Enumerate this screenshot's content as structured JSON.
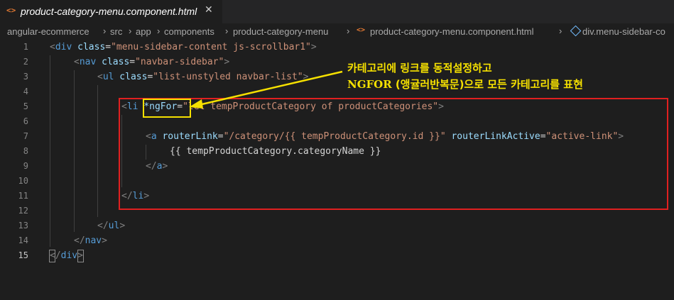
{
  "tab": {
    "icon": "<>",
    "label": "product-category-menu.component.html",
    "close": "✕"
  },
  "breadcrumb": {
    "items": [
      "angular-ecommerce",
      "src",
      "app",
      "components",
      "product-category-menu",
      "product-category-menu.component.html",
      "div.menu-sidebar-co"
    ],
    "separator": "›",
    "file_icon": "<>"
  },
  "editor": {
    "line_numbers": [
      "1",
      "2",
      "3",
      "4",
      "5",
      "6",
      "7",
      "8",
      "9",
      "10",
      "11",
      "12",
      "13",
      "14",
      "15"
    ],
    "active_line": "15",
    "lines": {
      "l1": {
        "open": "<",
        "tag": "div",
        "attr": " class",
        "eq": "=",
        "str": "\"menu-sidebar-content js-scrollbar1\"",
        "close": ">"
      },
      "l2": {
        "open": "<",
        "tag": "nav",
        "attr": " class",
        "eq": "=",
        "str": "\"navbar-sidebar\"",
        "close": ">"
      },
      "l3": {
        "open": "<",
        "tag": "ul",
        "attr": " class",
        "eq": "=",
        "str": "\"list-unstyled navbar-list\"",
        "close": ">"
      },
      "l5": {
        "open": "<",
        "tag": "li",
        "attr": " *ngFor",
        "eq": "=",
        "str": "\"let tempProductCategory of productCategories\"",
        "close": ">"
      },
      "l7": {
        "open": "<",
        "tag": "a",
        "attr1": " routerLink",
        "eq1": "=",
        "str1": "\"/category/{{ tempProductCategory.id }}\"",
        "attr2": " routerLinkActive",
        "eq2": "=",
        "str2": "\"active-link\"",
        "close": ">"
      },
      "l8": {
        "text": "{{ tempProductCategory.categoryName }}"
      },
      "l9": {
        "open": "</",
        "tag": "a",
        "close": ">"
      },
      "l11": {
        "open": "</",
        "tag": "li",
        "close": ">"
      },
      "l13": {
        "open": "</",
        "tag": "ul",
        "close": ">"
      },
      "l14": {
        "open": "</",
        "tag": "nav",
        "close": ">"
      },
      "l15": {
        "open": "<",
        "slash": "/",
        "tag": "div",
        "close": ">"
      }
    }
  },
  "annotation": {
    "line1": "카테고리에 링크를 동적설정하고",
    "line2_en": "NGFOR",
    "line2_ko": " (앵귤러반복문)으로 모든 카테고리를 표현"
  },
  "colors": {
    "background": "#1e1e1e",
    "tag": "#569cd6",
    "attribute": "#9cdcfe",
    "string": "#ce9178",
    "highlight_red": "#e02020",
    "highlight_yellow": "#f5e000"
  }
}
